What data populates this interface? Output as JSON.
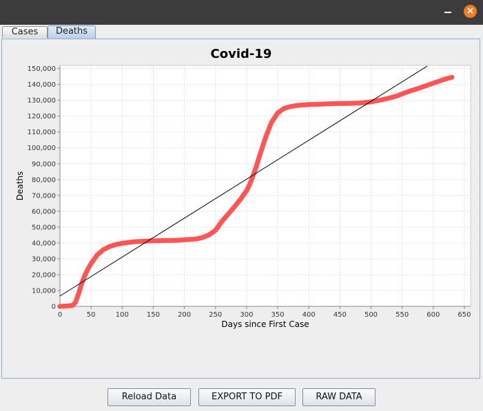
{
  "window": {
    "minimize_icon": "minimize-icon",
    "close_icon": "close-icon",
    "close_color": "#f07c25"
  },
  "tabs": [
    {
      "label": "Cases",
      "selected": false
    },
    {
      "label": "Deaths",
      "selected": true
    }
  ],
  "buttons": {
    "reload": "Reload Data",
    "export_pdf": "EXPORT TO PDF",
    "raw": "RAW DATA"
  },
  "chart_data": {
    "type": "line",
    "title": "Covid-19",
    "xlabel": "Days since First Case",
    "ylabel": "Deaths",
    "xlim": [
      0,
      660
    ],
    "ylim": [
      0,
      152000
    ],
    "x_ticks": [
      0,
      50,
      100,
      150,
      200,
      250,
      300,
      350,
      400,
      450,
      500,
      550,
      600,
      650
    ],
    "y_ticks": [
      0,
      10000,
      20000,
      30000,
      40000,
      50000,
      60000,
      70000,
      80000,
      90000,
      100000,
      110000,
      120000,
      130000,
      140000,
      150000
    ],
    "x_tick_labels": [
      "0",
      "50",
      "100",
      "150",
      "200",
      "250",
      "300",
      "350",
      "400",
      "450",
      "500",
      "550",
      "600",
      "650"
    ],
    "y_tick_labels": [
      "0",
      "10,000",
      "20,000",
      "30,000",
      "40,000",
      "50,000",
      "60,000",
      "70,000",
      "80,000",
      "90,000",
      "100,000",
      "110,000",
      "120,000",
      "130,000",
      "140,000",
      "150,000"
    ],
    "grid": true,
    "series": [
      {
        "color": "#ff5555",
        "x": [
          0,
          10,
          20,
          25,
          30,
          35,
          40,
          45,
          50,
          60,
          70,
          80,
          90,
          100,
          110,
          120,
          130,
          150,
          170,
          190,
          200,
          210,
          220,
          230,
          240,
          250,
          260,
          270,
          280,
          290,
          300,
          305,
          310,
          315,
          320,
          330,
          340,
          350,
          360,
          370,
          380,
          400,
          420,
          440,
          460,
          480,
          500,
          520,
          540,
          560,
          580,
          600,
          620,
          630
        ],
        "y": [
          0,
          200,
          500,
          2500,
          8000,
          14500,
          19500,
          23500,
          27000,
          32500,
          35800,
          37800,
          39000,
          39800,
          40300,
          40800,
          41000,
          41400,
          41500,
          41700,
          42000,
          42200,
          42600,
          43500,
          45200,
          48000,
          53500,
          58000,
          62500,
          67500,
          73000,
          77000,
          82000,
          87500,
          94000,
          106000,
          116000,
          122000,
          124800,
          126000,
          126700,
          127300,
          127600,
          127900,
          128000,
          128200,
          129000,
          130500,
          132500,
          135500,
          138000,
          140800,
          143500,
          144500
        ]
      },
      {
        "color": "#000000",
        "x": [
          0,
          590
        ],
        "y": [
          6500,
          151500
        ]
      }
    ]
  }
}
